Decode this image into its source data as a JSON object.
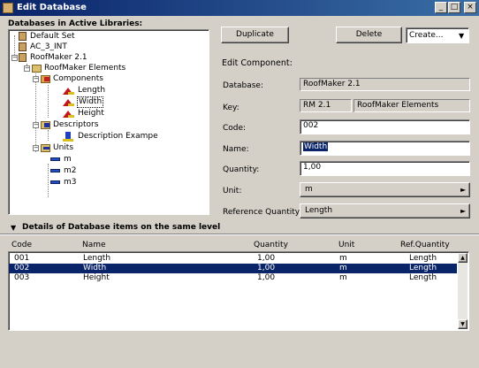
{
  "window": {
    "title": "Edit Database",
    "buttons": [
      "_",
      "□",
      "×"
    ]
  },
  "tree": {
    "header": "Databases in Active Libraries:",
    "items": [
      {
        "label": "Default Set",
        "icon": "database-icon",
        "depth": 0
      },
      {
        "label": "AC_3_INT",
        "icon": "database-icon",
        "depth": 0
      },
      {
        "label": "RoofMaker 2.1",
        "icon": "database-icon",
        "depth": 0
      },
      {
        "label": "RoofMaker Elements",
        "icon": "folder-icon",
        "depth": 1
      },
      {
        "label": "Components",
        "icon": "components-folder-icon",
        "depth": 2
      },
      {
        "label": "Length",
        "icon": "component-icon",
        "depth": 3
      },
      {
        "label": "Width",
        "icon": "component-icon",
        "depth": 3,
        "selected": true
      },
      {
        "label": "Height",
        "icon": "component-icon",
        "depth": 3
      },
      {
        "label": "Descriptors",
        "icon": "descriptors-folder-icon",
        "depth": 2
      },
      {
        "label": "Description Exampe",
        "icon": "descriptor-icon",
        "depth": 3
      },
      {
        "label": "Units",
        "icon": "units-folder-icon",
        "depth": 2
      },
      {
        "label": "m",
        "icon": "unit-icon",
        "depth": 3
      },
      {
        "label": "m2",
        "icon": "unit-icon",
        "depth": 3
      },
      {
        "label": "m3",
        "icon": "unit-icon",
        "depth": 3
      }
    ]
  },
  "actions": {
    "duplicate": "Duplicate",
    "delete": "Delete",
    "create": "Create..."
  },
  "form": {
    "heading": "Edit Component:",
    "database_label": "Database:",
    "database_value": "RoofMaker 2.1",
    "key_label": "Key:",
    "key_value_1": "RM 2.1",
    "key_value_2": "RoofMaker Elements",
    "code_label": "Code:",
    "code_value": "002",
    "name_label": "Name:",
    "name_value": "Width",
    "quantity_label": "Quantity:",
    "quantity_value": "1,00",
    "unit_label": "Unit:",
    "unit_value": "m",
    "refq_label": "Reference Quantity:",
    "refq_value": "Length"
  },
  "details": {
    "header": "Details of Database items on the same level",
    "columns": [
      "Code",
      "Name",
      "Quantity",
      "Unit",
      "Ref.Quantity"
    ],
    "rows": [
      {
        "code": "001",
        "name": "Length",
        "quantity": "1,00",
        "unit": "m",
        "ref": "Length"
      },
      {
        "code": "002",
        "name": "Width",
        "quantity": "1,00",
        "unit": "m",
        "ref": "Length",
        "selected": true
      },
      {
        "code": "003",
        "name": "Height",
        "quantity": "1,00",
        "unit": "m",
        "ref": "Length"
      }
    ]
  }
}
